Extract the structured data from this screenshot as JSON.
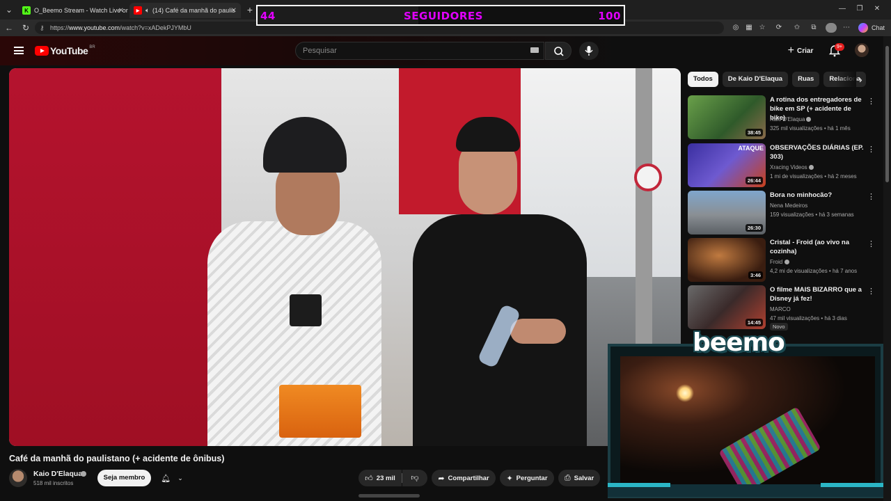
{
  "browser": {
    "tabs": [
      {
        "label": "O_Beemo Stream - Watch Live on",
        "icon": "kick-icon",
        "active": false
      },
      {
        "label": "(14) Café da manhã do paulis",
        "icon": "youtube-icon",
        "active": true
      }
    ],
    "url_prefix": "https://",
    "url_host": "www.youtube.com",
    "url_path": "/watch?v=xADekPJYMbU",
    "chat_label": "Chat"
  },
  "overlay": {
    "followers_current": "44",
    "followers_label": "SEGUIDORES",
    "followers_goal": "100",
    "progress": 0.44,
    "brand": "beemo",
    "accent": "#e100ff"
  },
  "youtube": {
    "logo_text": "YouTube",
    "region": "BR",
    "search_placeholder": "Pesquisar",
    "create_label": "Criar",
    "notif_count": "9+"
  },
  "video": {
    "title": "Café da manhã do paulistano (+ acidente de ônibus)",
    "channel": "Kaio D'Elaqua",
    "subscribers": "518 mil inscritos",
    "join_label": "Seja membro",
    "likes": "23 mil",
    "share_label": "Compartilhar",
    "ask_label": "Perguntar",
    "save_label": "Salvar"
  },
  "sidebar": {
    "chips": [
      "Todos",
      "De Kaio D'Elaqua",
      "Ruas",
      "Relaciona"
    ],
    "recs": [
      {
        "title": "A rotina dos entregadores de bike em SP (+ acidente de bike)",
        "channel": "Kaio D'Elaqua",
        "meta": "325 mil visualizações • há 1 mês",
        "duration": "38:45",
        "verified": true,
        "thumb_color": "#4a7a3a"
      },
      {
        "title": "OBSERVAÇÕES DIÁRIAS (EP. 303)",
        "channel": "Xracing Videos",
        "meta": "1 mi de visualizações • há 2 meses",
        "duration": "26:44",
        "verified": true,
        "thumb_color": "#4a3fb0"
      },
      {
        "title": "Bora no minhocão?",
        "channel": "Nena Medeiros",
        "meta": "159 visualizações • há 3 semanas",
        "duration": "26:30",
        "verified": false,
        "thumb_color": "#6f8aa6"
      },
      {
        "title": "Cristal - Froid (ao vivo na cozinha)",
        "channel": "Froid",
        "meta": "4,2 mi de visualizações • há 7 anos",
        "duration": "3:46",
        "verified": true,
        "thumb_color": "#6a3a1e"
      },
      {
        "title": "O filme MAIS BIZARRO que a Disney já fez!",
        "channel": "MARCO",
        "meta": "47 mil visualizações • há 3 dias",
        "duration": "14:45",
        "verified": false,
        "badge": "Novo",
        "thumb_color": "#4a3b3f"
      }
    ]
  }
}
